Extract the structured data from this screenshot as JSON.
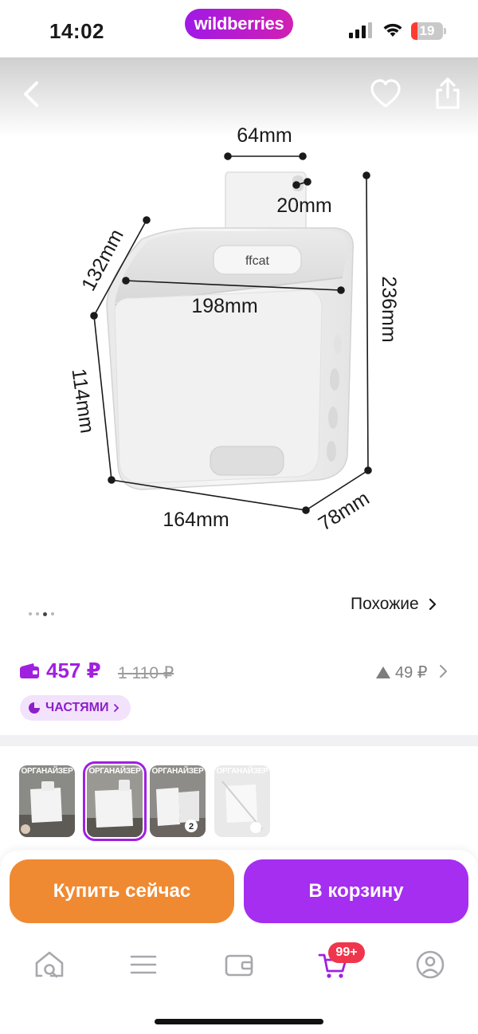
{
  "status_bar": {
    "time": "14:02",
    "app_pill": "wildberries",
    "battery": "19"
  },
  "gallery": {
    "dimensions": {
      "handle_width": "64mm",
      "hook": "20mm",
      "depth_top": "132mm",
      "top_width": "198mm",
      "total_height": "236mm",
      "side_height": "114mm",
      "bottom_width": "164mm",
      "bottom_depth": "78mm"
    },
    "brand_on_product": "ffcat",
    "dots_count": 4,
    "active_dot": 2,
    "similar_label": "Похожие"
  },
  "price": {
    "current": "457 ₽",
    "old": "1 110 ₽",
    "change": "49 ₽",
    "installment_label": "ЧАСТЯМИ"
  },
  "thumbnails": [
    {
      "title": "ОРГАНАЙЗЕР",
      "selected": false,
      "badge": ""
    },
    {
      "title": "ОРГАНАЙЗЕР",
      "selected": true,
      "badge": ""
    },
    {
      "title": "ОРГАНАЙЗЕР",
      "selected": false,
      "badge": "2"
    },
    {
      "title": "ОРГАНАЙЗЕР",
      "selected": false,
      "badge": ""
    }
  ],
  "actions": {
    "buy_now": "Купить сейчас",
    "add_to_cart": "В корзину"
  },
  "tabbar": {
    "items": [
      "home-search-icon",
      "menu-icon",
      "wallet-icon",
      "cart-icon",
      "profile-icon"
    ],
    "cart_badge": "99+"
  },
  "colors": {
    "accent": "#a020e0",
    "buy_now": "#f08a32",
    "to_cart": "#a52ef0",
    "badge": "#f0364c"
  }
}
